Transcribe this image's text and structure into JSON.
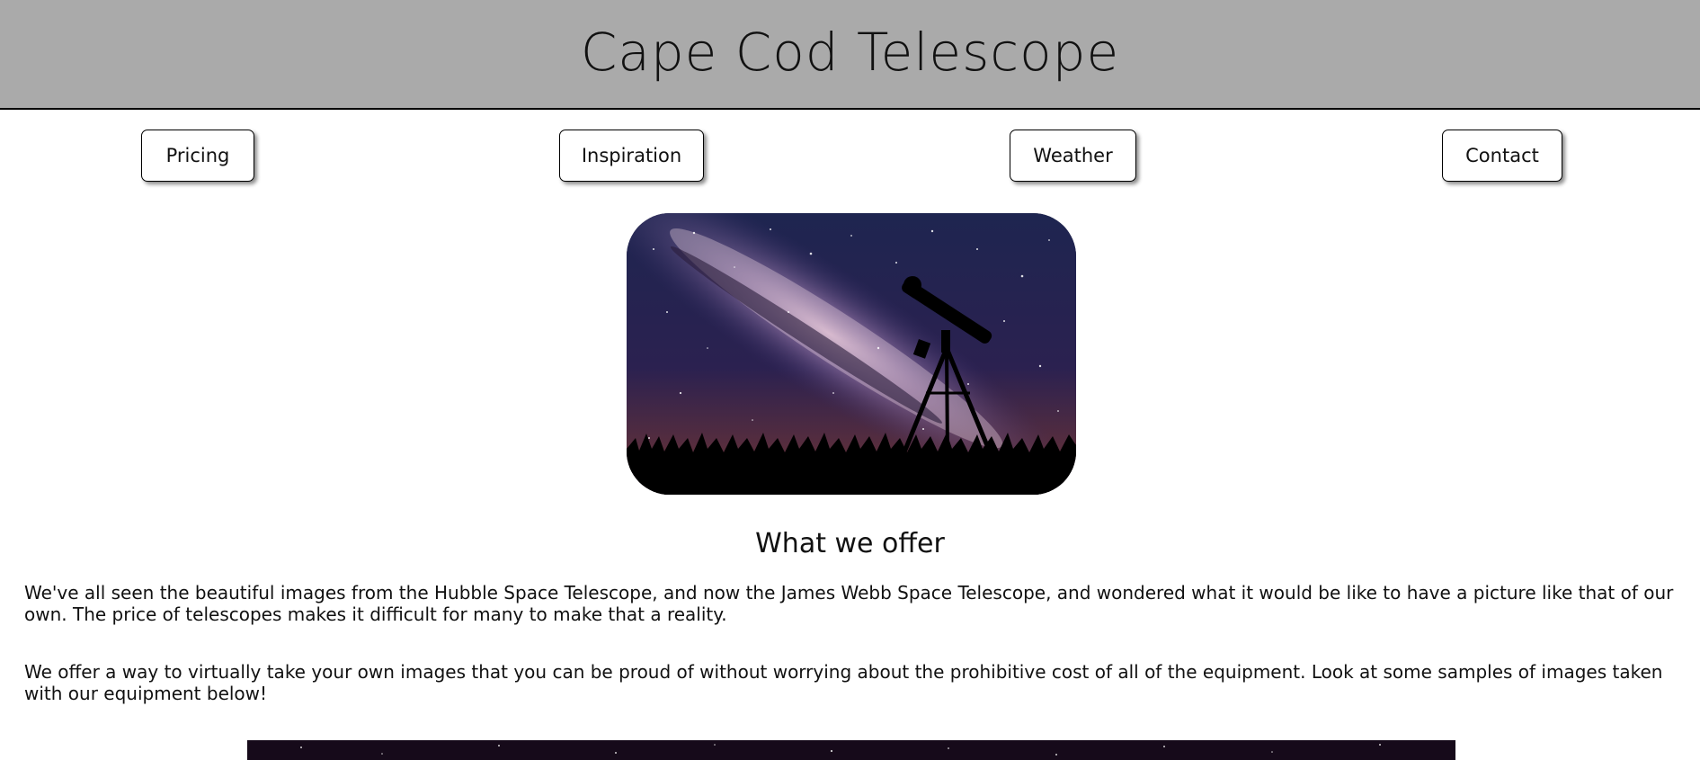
{
  "header": {
    "title": "Cape Cod Telescope",
    "background_color": "#aaaaaa"
  },
  "nav": {
    "items": [
      {
        "label": "Pricing"
      },
      {
        "label": "Inspiration"
      },
      {
        "label": "Weather"
      },
      {
        "label": "Contact"
      }
    ]
  },
  "hero": {
    "image": "telescope-silhouette-under-milky-way"
  },
  "offer": {
    "heading": "What we offer",
    "paragraphs": [
      "We've all seen the beautiful images from the Hubble Space Telescope, and now the James Webb Space Telescope, and wondered what it would be like to have a picture like that of our own. The price of telescopes makes it difficult for many to make that a reality.",
      "We offer a way to virtually take your own images that you can be proud of without worrying about the prohibitive cost of all of the equipment. Look at some samples of images taken with our equipment below!"
    ]
  },
  "gallery": {
    "image": "night-sky-sample-image"
  }
}
